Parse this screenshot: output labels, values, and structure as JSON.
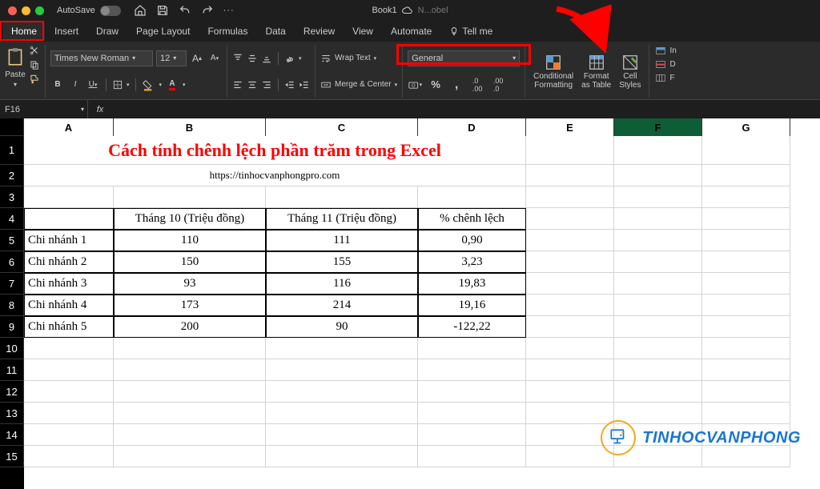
{
  "titlebar": {
    "autosave_label": "AutoSave",
    "doc_name": "Book1",
    "cloud_hint": "N...obel"
  },
  "menutabs": {
    "items": [
      "Home",
      "Insert",
      "Draw",
      "Page Layout",
      "Formulas",
      "Data",
      "Review",
      "View",
      "Automate"
    ],
    "tellme": "Tell me"
  },
  "ribbon": {
    "paste_label": "Paste",
    "font_name": "Times New Roman",
    "font_size": "12",
    "wrap_text": "Wrap Text",
    "merge_center": "Merge & Center",
    "number_format": "General",
    "cond_fmt": "Conditional\nFormatting",
    "fmt_table": "Format\nas Table",
    "cell_styles": "Cell\nStyles",
    "insert": "In",
    "delete": "D",
    "format": "F"
  },
  "formula_bar": {
    "namebox": "F16",
    "fx": "fx",
    "formula": ""
  },
  "grid": {
    "col_headers": [
      "A",
      "B",
      "C",
      "D",
      "E",
      "F",
      "G"
    ],
    "row_headers": [
      "1",
      "2",
      "3",
      "4",
      "5",
      "6",
      "7",
      "8",
      "9",
      "10",
      "11",
      "12",
      "13",
      "14",
      "15"
    ],
    "selected_col": "F",
    "title": "Cách tính chênh lệch phần trăm trong Excel",
    "subtitle": "https://tinhocvanphongpro.com",
    "table": {
      "headers": [
        "",
        "Tháng 10 (Triệu đồng)",
        "Tháng 11 (Triệu đồng)",
        "% chênh lệch"
      ],
      "rows": [
        {
          "label": "Chi nhánh 1",
          "b": "110",
          "c": "111",
          "d": "0,90"
        },
        {
          "label": "Chi nhánh 2",
          "b": "150",
          "c": "155",
          "d": "3,23"
        },
        {
          "label": "Chi nhánh 3",
          "b": "93",
          "c": "116",
          "d": "19,83"
        },
        {
          "label": "Chi nhánh 4",
          "b": "173",
          "c": "214",
          "d": "19,16"
        },
        {
          "label": "Chi nhánh 5",
          "b": "200",
          "c": "90",
          "d": "-122,22"
        }
      ]
    }
  },
  "watermark": {
    "text": "TINHOCVANPHONG"
  },
  "chart_data": {
    "type": "table",
    "title": "Cách tính chênh lệch phần trăm trong Excel",
    "columns": [
      "Chi nhánh",
      "Tháng 10 (Triệu đồng)",
      "Tháng 11 (Triệu đồng)",
      "% chênh lệch"
    ],
    "rows": [
      [
        "Chi nhánh 1",
        110,
        111,
        0.9
      ],
      [
        "Chi nhánh 2",
        150,
        155,
        3.23
      ],
      [
        "Chi nhánh 3",
        93,
        116,
        19.83
      ],
      [
        "Chi nhánh 4",
        173,
        214,
        19.16
      ],
      [
        "Chi nhánh 5",
        200,
        90,
        -122.22
      ]
    ]
  }
}
